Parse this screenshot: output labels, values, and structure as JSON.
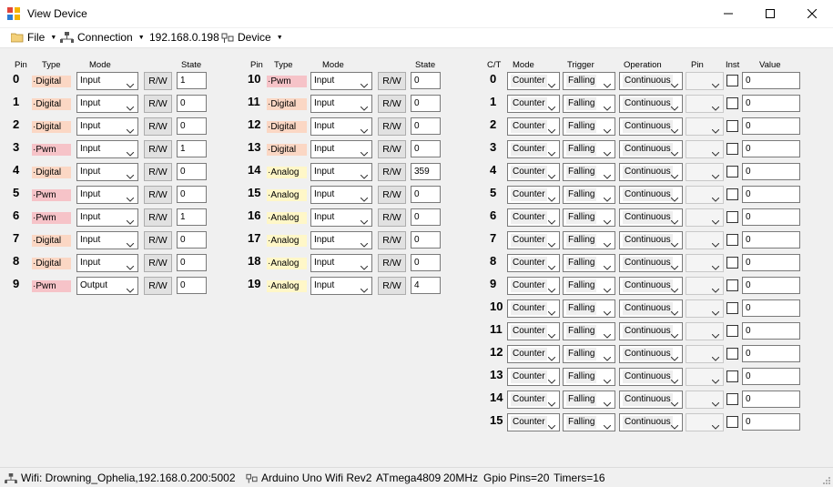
{
  "window": {
    "title": "View Device",
    "icon": "app-grid-icon"
  },
  "menu": {
    "file": "File",
    "connection": "Connection",
    "address": "192.168.0.198",
    "device": "Device"
  },
  "headers": {
    "pin": "Pin",
    "type": "Type",
    "mode": "Mode",
    "state": "State",
    "ct": "C/T",
    "ct_mode": "Mode",
    "trigger": "Trigger",
    "operation": "Operation",
    "ct_pin": "Pin",
    "inst": "Inst",
    "value": "Value"
  },
  "rw_label": "R/W",
  "gpio_left": [
    {
      "pin": "0",
      "type": "·Digital",
      "kind": "Digital",
      "mode": "Input",
      "state": "1"
    },
    {
      "pin": "1",
      "type": "·Digital",
      "kind": "Digital",
      "mode": "Input",
      "state": "0"
    },
    {
      "pin": "2",
      "type": "·Digital",
      "kind": "Digital",
      "mode": "Input",
      "state": "0"
    },
    {
      "pin": "3",
      "type": "·Pwm",
      "kind": "Pwm",
      "mode": "Input",
      "state": "1"
    },
    {
      "pin": "4",
      "type": "·Digital",
      "kind": "Digital",
      "mode": "Input",
      "state": "0"
    },
    {
      "pin": "5",
      "type": "·Pwm",
      "kind": "Pwm",
      "mode": "Input",
      "state": "0"
    },
    {
      "pin": "6",
      "type": "·Pwm",
      "kind": "Pwm",
      "mode": "Input",
      "state": "1"
    },
    {
      "pin": "7",
      "type": "·Digital",
      "kind": "Digital",
      "mode": "Input",
      "state": "0"
    },
    {
      "pin": "8",
      "type": "·Digital",
      "kind": "Digital",
      "mode": "Input",
      "state": "0"
    },
    {
      "pin": "9",
      "type": "·Pwm",
      "kind": "Pwm",
      "mode": "Output",
      "state": "0"
    }
  ],
  "gpio_right": [
    {
      "pin": "10",
      "type": "·Pwm",
      "kind": "Pwm",
      "mode": "Input",
      "state": "0"
    },
    {
      "pin": "11",
      "type": "·Digital",
      "kind": "Digital",
      "mode": "Input",
      "state": "0"
    },
    {
      "pin": "12",
      "type": "·Digital",
      "kind": "Digital",
      "mode": "Input",
      "state": "0"
    },
    {
      "pin": "13",
      "type": "·Digital",
      "kind": "Digital",
      "mode": "Input",
      "state": "0"
    },
    {
      "pin": "14",
      "type": "·Analog",
      "kind": "Analog",
      "mode": "Input",
      "state": "359"
    },
    {
      "pin": "15",
      "type": "·Analog",
      "kind": "Analog",
      "mode": "Input",
      "state": "0"
    },
    {
      "pin": "16",
      "type": "·Analog",
      "kind": "Analog",
      "mode": "Input",
      "state": "0"
    },
    {
      "pin": "17",
      "type": "·Analog",
      "kind": "Analog",
      "mode": "Input",
      "state": "0"
    },
    {
      "pin": "18",
      "type": "·Analog",
      "kind": "Analog",
      "mode": "Input",
      "state": "0"
    },
    {
      "pin": "19",
      "type": "·Analog",
      "kind": "Analog",
      "mode": "Input",
      "state": "4"
    }
  ],
  "counters": [
    {
      "id": "0",
      "mode": "Counter",
      "trigger": "Falling",
      "operation": "Continuous",
      "pin": "",
      "inst": false,
      "value": "0"
    },
    {
      "id": "1",
      "mode": "Counter",
      "trigger": "Falling",
      "operation": "Continuous",
      "pin": "",
      "inst": false,
      "value": "0"
    },
    {
      "id": "2",
      "mode": "Counter",
      "trigger": "Falling",
      "operation": "Continuous",
      "pin": "",
      "inst": false,
      "value": "0"
    },
    {
      "id": "3",
      "mode": "Counter",
      "trigger": "Falling",
      "operation": "Continuous",
      "pin": "",
      "inst": false,
      "value": "0"
    },
    {
      "id": "4",
      "mode": "Counter",
      "trigger": "Falling",
      "operation": "Continuous",
      "pin": "",
      "inst": false,
      "value": "0"
    },
    {
      "id": "5",
      "mode": "Counter",
      "trigger": "Falling",
      "operation": "Continuous",
      "pin": "",
      "inst": false,
      "value": "0"
    },
    {
      "id": "6",
      "mode": "Counter",
      "trigger": "Falling",
      "operation": "Continuous",
      "pin": "",
      "inst": false,
      "value": "0"
    },
    {
      "id": "7",
      "mode": "Counter",
      "trigger": "Falling",
      "operation": "Continuous",
      "pin": "",
      "inst": false,
      "value": "0"
    },
    {
      "id": "8",
      "mode": "Counter",
      "trigger": "Falling",
      "operation": "Continuous",
      "pin": "",
      "inst": false,
      "value": "0"
    },
    {
      "id": "9",
      "mode": "Counter",
      "trigger": "Falling",
      "operation": "Continuous",
      "pin": "",
      "inst": false,
      "value": "0"
    },
    {
      "id": "10",
      "mode": "Counter",
      "trigger": "Falling",
      "operation": "Continuous",
      "pin": "",
      "inst": false,
      "value": "0"
    },
    {
      "id": "11",
      "mode": "Counter",
      "trigger": "Falling",
      "operation": "Continuous",
      "pin": "",
      "inst": false,
      "value": "0"
    },
    {
      "id": "12",
      "mode": "Counter",
      "trigger": "Falling",
      "operation": "Continuous",
      "pin": "",
      "inst": false,
      "value": "0"
    },
    {
      "id": "13",
      "mode": "Counter",
      "trigger": "Falling",
      "operation": "Continuous",
      "pin": "",
      "inst": false,
      "value": "0"
    },
    {
      "id": "14",
      "mode": "Counter",
      "trigger": "Falling",
      "operation": "Continuous",
      "pin": "",
      "inst": false,
      "value": "0"
    },
    {
      "id": "15",
      "mode": "Counter",
      "trigger": "Falling",
      "operation": "Continuous",
      "pin": "",
      "inst": false,
      "value": "0"
    }
  ],
  "status": {
    "wifi": "Wifi: Drowning_Ophelia,192.168.0.200:5002",
    "board": "Arduino Uno Wifi Rev2",
    "mcu": "ATmega4809",
    "clock": "20MHz",
    "gpio_pins": "Gpio Pins=20",
    "timers": "Timers=16"
  },
  "colors": {
    "digital": "#fbd7c4",
    "pwm": "#f6c3c8",
    "analog": "#fff7c8",
    "window_bg": "#f0f0f0"
  }
}
